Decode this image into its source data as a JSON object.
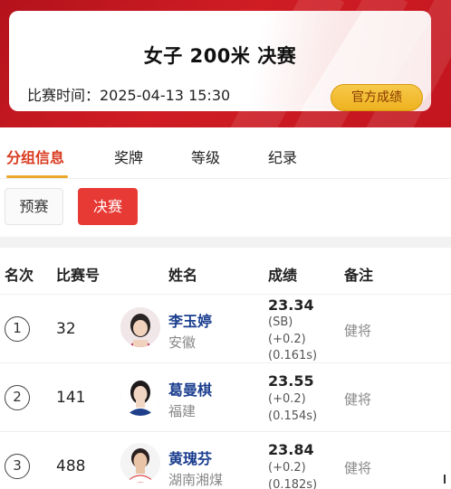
{
  "event": {
    "title": "女子 200米 决赛",
    "time_label": "比赛时间：2025-04-13  15:30",
    "official_button": "官方成绩"
  },
  "tabs": [
    {
      "label": "分组信息",
      "active": true
    },
    {
      "label": "奖牌",
      "active": false
    },
    {
      "label": "等级",
      "active": false
    },
    {
      "label": "纪录",
      "active": false
    }
  ],
  "subtabs": {
    "heats": "预赛",
    "final": "决赛"
  },
  "table": {
    "headers": {
      "rank": "名次",
      "bib": "比赛号",
      "name": "姓名",
      "result": "成绩",
      "note": "备注"
    },
    "rows": [
      {
        "rank": "1",
        "bib": "32",
        "name": "李玉婷",
        "region": "安徽",
        "result": "23.34",
        "extra": [
          "(SB)",
          "(+0.2)",
          "(0.161s)"
        ],
        "note": "健将"
      },
      {
        "rank": "2",
        "bib": "141",
        "name": "葛曼棋",
        "region": "福建",
        "result": "23.55",
        "extra": [
          "(+0.2)",
          "(0.154s)"
        ],
        "note": "健将"
      },
      {
        "rank": "3",
        "bib": "488",
        "name": "黄瑰芬",
        "region": "湖南湘煤",
        "result": "23.84",
        "extra": [
          "(+0.2)",
          "(0.182s)"
        ],
        "note": "健将"
      }
    ]
  },
  "colors": {
    "brand_red": "#d01d24",
    "active_tab": "#d93a1f",
    "name_blue": "#1b3e8f",
    "gold": "#eeb21f"
  }
}
